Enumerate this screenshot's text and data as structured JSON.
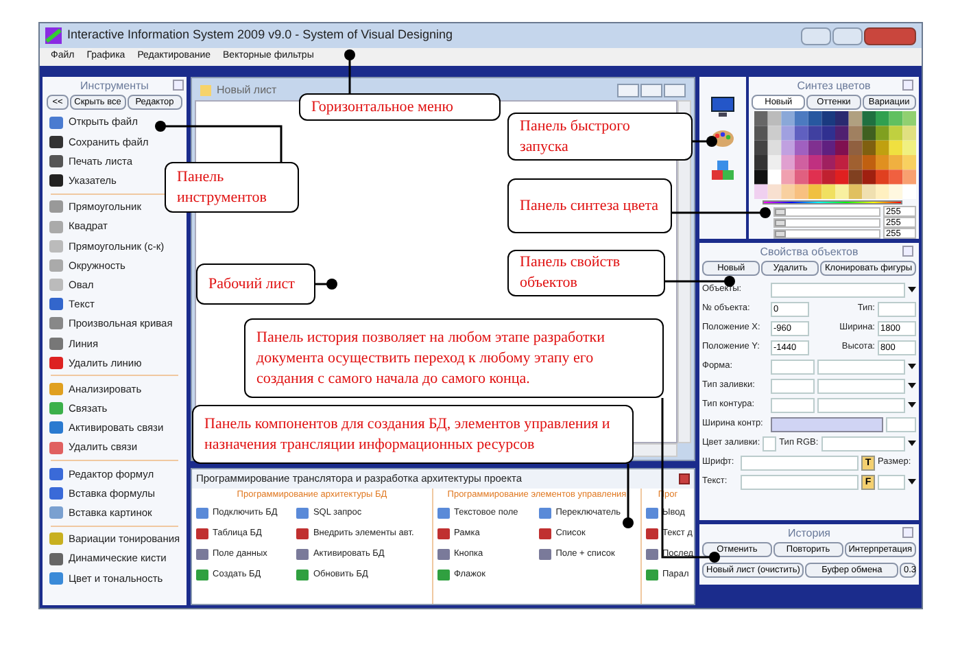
{
  "window": {
    "title": "Interactive Information System 2009 v9.0 - System of Visual Designing"
  },
  "menu": [
    "Файл",
    "Графика",
    "Редактирование",
    "Векторные фильтры"
  ],
  "tools_panel": {
    "title": "Инструменты",
    "buttons": [
      "<<",
      "Скрыть все",
      "Редактор"
    ],
    "groups": [
      [
        "Открыть файл",
        "Сохранить файл",
        "Печать листа",
        "Указатель"
      ],
      [
        "Прямоугольник",
        "Квадрат",
        "Прямоугольник (с-к)",
        "Окружность",
        "Овал",
        "Текст",
        "Произвольная кривая",
        "Линия",
        "Удалить линию"
      ],
      [
        "Анализировать",
        "Связать",
        "Активировать связи",
        "Удалить связи"
      ],
      [
        "Редактор формул",
        "Вставка формулы",
        "Вставка картинок"
      ],
      [
        "Вариации тонирования",
        "Динамические кисти",
        "Цвет и тональность"
      ]
    ]
  },
  "worksheet": {
    "title": "Новый лист"
  },
  "color_panel": {
    "title": "Синтез цветов",
    "tabs": [
      {
        "label": "Новый",
        "selected": true
      },
      {
        "label": "Оттенки",
        "selected": false
      },
      {
        "label": "Вариации",
        "selected": false
      }
    ],
    "sliders": [
      {
        "level": 0,
        "value": "255"
      },
      {
        "level": 0,
        "value": "255"
      },
      {
        "level": 0,
        "value": "255"
      }
    ]
  },
  "properties_panel": {
    "title": "Свойства объектов",
    "buttons": [
      "Новый",
      "Удалить",
      "Клонировать фигуры"
    ],
    "rows": [
      {
        "kind": "dropdown",
        "label": "Объекты:"
      },
      {
        "kind": "pair",
        "fields": [
          {
            "label": "№ объекта:",
            "value": "0"
          },
          {
            "label": "Тип:"
          }
        ]
      },
      {
        "kind": "pair",
        "fields": [
          {
            "label": "Положение X:",
            "value": "-960"
          },
          {
            "label": "Ширина:",
            "value": "1800"
          }
        ]
      },
      {
        "kind": "pair",
        "fields": [
          {
            "label": "Положение Y:",
            "value": "-1440"
          },
          {
            "label": "Высота:",
            "value": "800"
          }
        ]
      },
      {
        "kind": "style",
        "label": "Форма:"
      },
      {
        "kind": "style",
        "label": "Тип заливки:"
      },
      {
        "kind": "style",
        "label": "Тип контура:"
      },
      {
        "kind": "width",
        "label": "Ширина контр:"
      },
      {
        "kind": "color",
        "label": "Цвет заливки:",
        "label2": "Тип RGB:"
      },
      {
        "kind": "font",
        "label": "Шрифт:",
        "button": "T",
        "label2": "Размер:"
      },
      {
        "kind": "font",
        "label": "Текст:",
        "button": "F"
      }
    ]
  },
  "history_panel": {
    "title": "История",
    "buttons": [
      "Отменить",
      "Повторить",
      "Интерпретация"
    ],
    "bottom_buttons": [
      "Новый лист (очистить)",
      "Буфер обмена",
      "0.3"
    ]
  },
  "components_panel": {
    "title": "Программирование транслятора и разработка архитектуры проекта",
    "sections": [
      {
        "title": "Программирование архитектуры БД",
        "items": [
          "Подключить БД",
          "Таблица БД",
          "Поле данных",
          "Создать БД",
          "SQL запрос",
          "Внедрить элементы авт.",
          "Активировать БД",
          "Обновить БД"
        ]
      },
      {
        "title": "Программирование элементов управления",
        "items": [
          "Текстовое поле",
          "Рамка",
          "Кнопка",
          "Флажок",
          "Переключатель",
          "Список",
          "Поле + список"
        ]
      },
      {
        "title": "Прог",
        "items": [
          "Ывод",
          "Текст д",
          "Послед",
          "Парал"
        ]
      }
    ]
  },
  "callouts": [
    {
      "text": "Горизонтальное меню"
    },
    {
      "text": "Панель инструментов"
    },
    {
      "text": "Панель быстрого запуска"
    },
    {
      "text": "Панель синтеза цвета"
    },
    {
      "text": "Рабочий лист"
    },
    {
      "text": "Панель свойств объектов"
    },
    {
      "text": "Панель история позволяет на любом этапе разработки документа осуществить переход к любому этапу его создания с самого начала до самого конца."
    },
    {
      "text": "Панель компонентов для создания БД, элементов управления и назначения трансляции информационных ресурсов"
    }
  ]
}
